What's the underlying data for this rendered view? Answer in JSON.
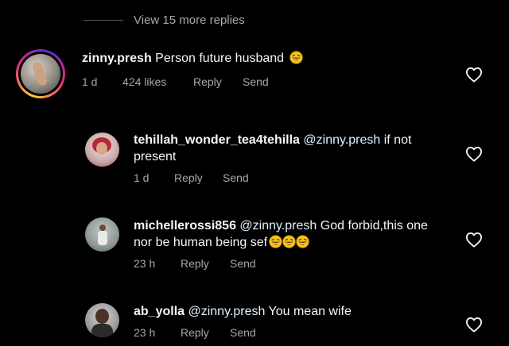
{
  "more_replies": "View 15 more replies",
  "comments": [
    {
      "username": "zinny.presh",
      "text": "Person future husband",
      "emoji_count": 1,
      "time": "1 d",
      "likes": "424 likes",
      "reply_label": "Reply",
      "send_label": "Send"
    },
    {
      "username": "tehillah_wonder_tea4tehilla",
      "mention": "@zinny.presh",
      "text_line1": "if not",
      "text_line2": "present",
      "time": "1 d",
      "reply_label": "Reply",
      "send_label": "Send"
    },
    {
      "username": "michellerossi856",
      "mention": "@zinny.presh",
      "text_line1": "God forbid,this one",
      "text_line2": "nor be human being sef",
      "emoji_count": 3,
      "time": "23 h",
      "reply_label": "Reply",
      "send_label": "Send"
    },
    {
      "username": "ab_yolla",
      "mention": "@zinny.presh",
      "text": "You mean wife",
      "time": "23 h",
      "reply_label": "Reply",
      "send_label": "Send"
    }
  ],
  "colors": {
    "background": "#000000",
    "text": "#f5f5f5",
    "muted": "#a8a8a8",
    "mention": "#e0f1ff",
    "story_ring_start": "#f9ce34",
    "story_ring_mid": "#ee2a7b",
    "story_ring_end": "#6228d7"
  },
  "icons": [
    "heart-outline-icon",
    "laughing-emoji-icon"
  ]
}
